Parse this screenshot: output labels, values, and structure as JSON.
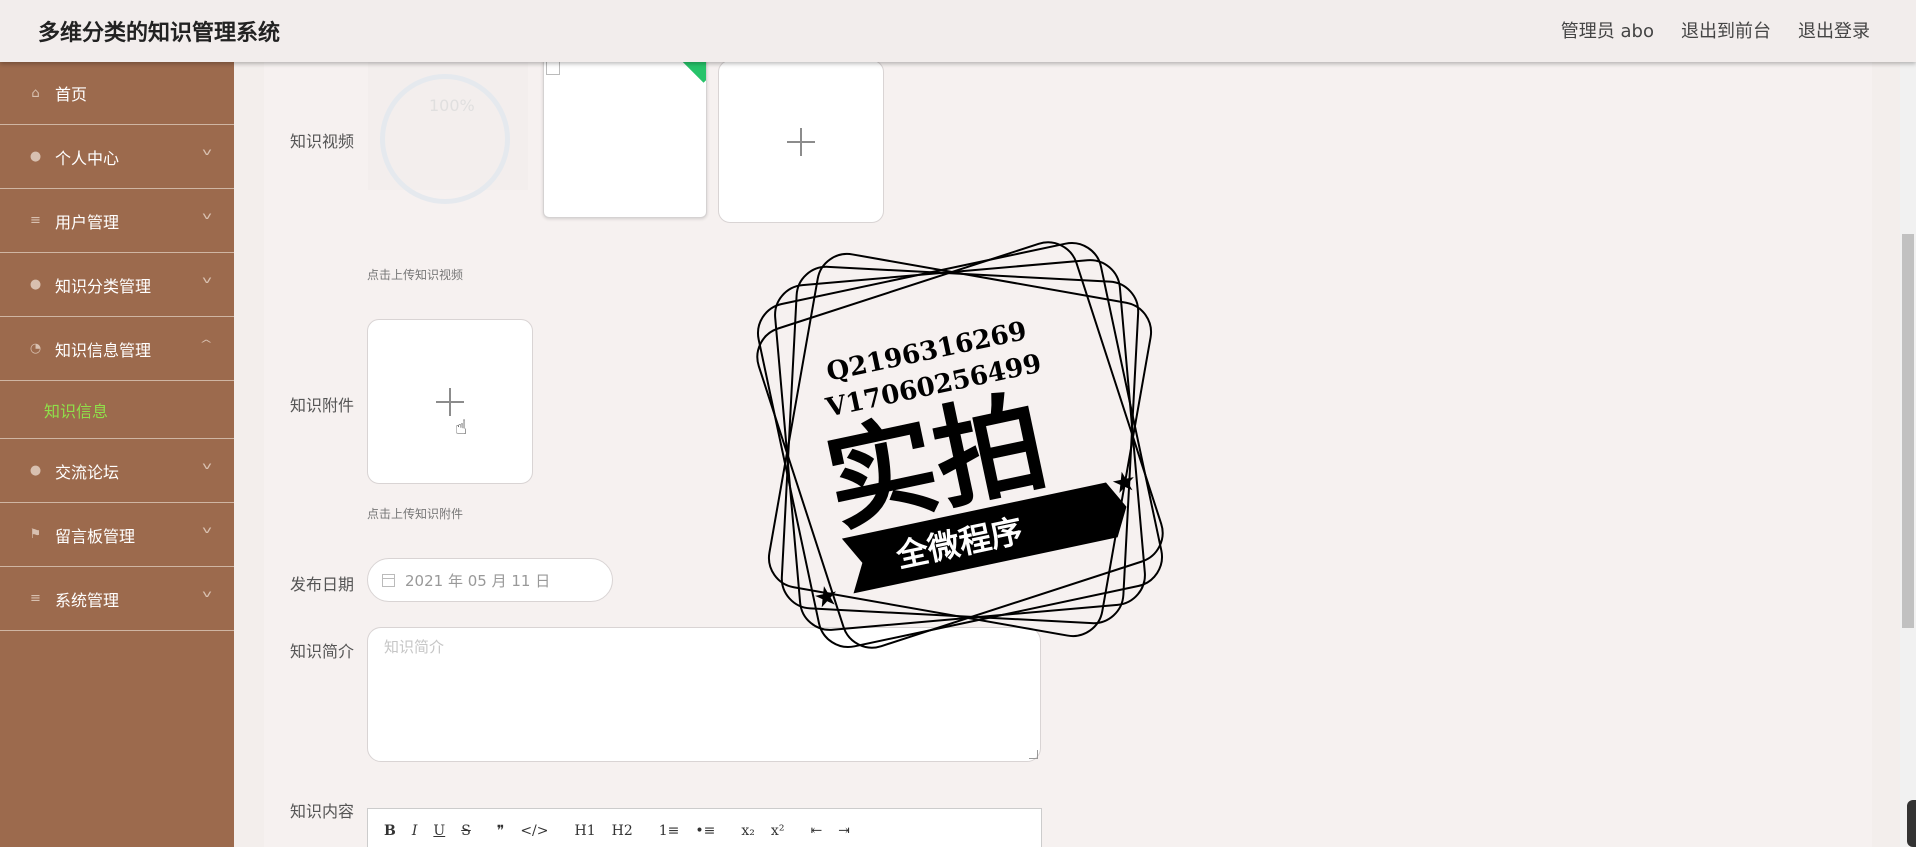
{
  "app": {
    "title": "多维分类的知识管理系统"
  },
  "topbar": {
    "admin": "管理员 abo",
    "front": "退出到前台",
    "logout": "退出登录"
  },
  "sidebar": {
    "items": [
      {
        "label": "首页",
        "icon": "home-icon"
      },
      {
        "label": "个人中心",
        "icon": "user-icon"
      },
      {
        "label": "用户管理",
        "icon": "list-icon"
      },
      {
        "label": "知识分类管理",
        "icon": "user-icon"
      },
      {
        "label": "知识信息管理",
        "icon": "dashboard-icon"
      },
      {
        "label": "交流论坛",
        "icon": "user-icon"
      },
      {
        "label": "留言板管理",
        "icon": "flag-icon"
      },
      {
        "label": "系统管理",
        "icon": "list-icon"
      }
    ],
    "sub_item": "知识信息"
  },
  "form": {
    "video_label": "知识视频",
    "progress_text": "100%",
    "video_hint": "点击上传知识视频",
    "attachment_label": "知识附件",
    "attachment_hint": "点击上传知识附件",
    "date_label": "发布日期",
    "date_value": "2021 年 05 月 11 日",
    "intro_label": "知识简介",
    "intro_placeholder": "知识简介",
    "content_label": "知识内容"
  },
  "editor_toolbar": [
    "B",
    "I",
    "U",
    "S",
    "❞",
    "</>",
    "H1",
    "H2",
    "1≡",
    "•≡",
    "x₂",
    "x²",
    "⇤",
    "⇥"
  ],
  "watermark": {
    "line1": "Q2196316269",
    "line2": "V17060256499",
    "main": "实拍",
    "banner": "全微程序"
  }
}
